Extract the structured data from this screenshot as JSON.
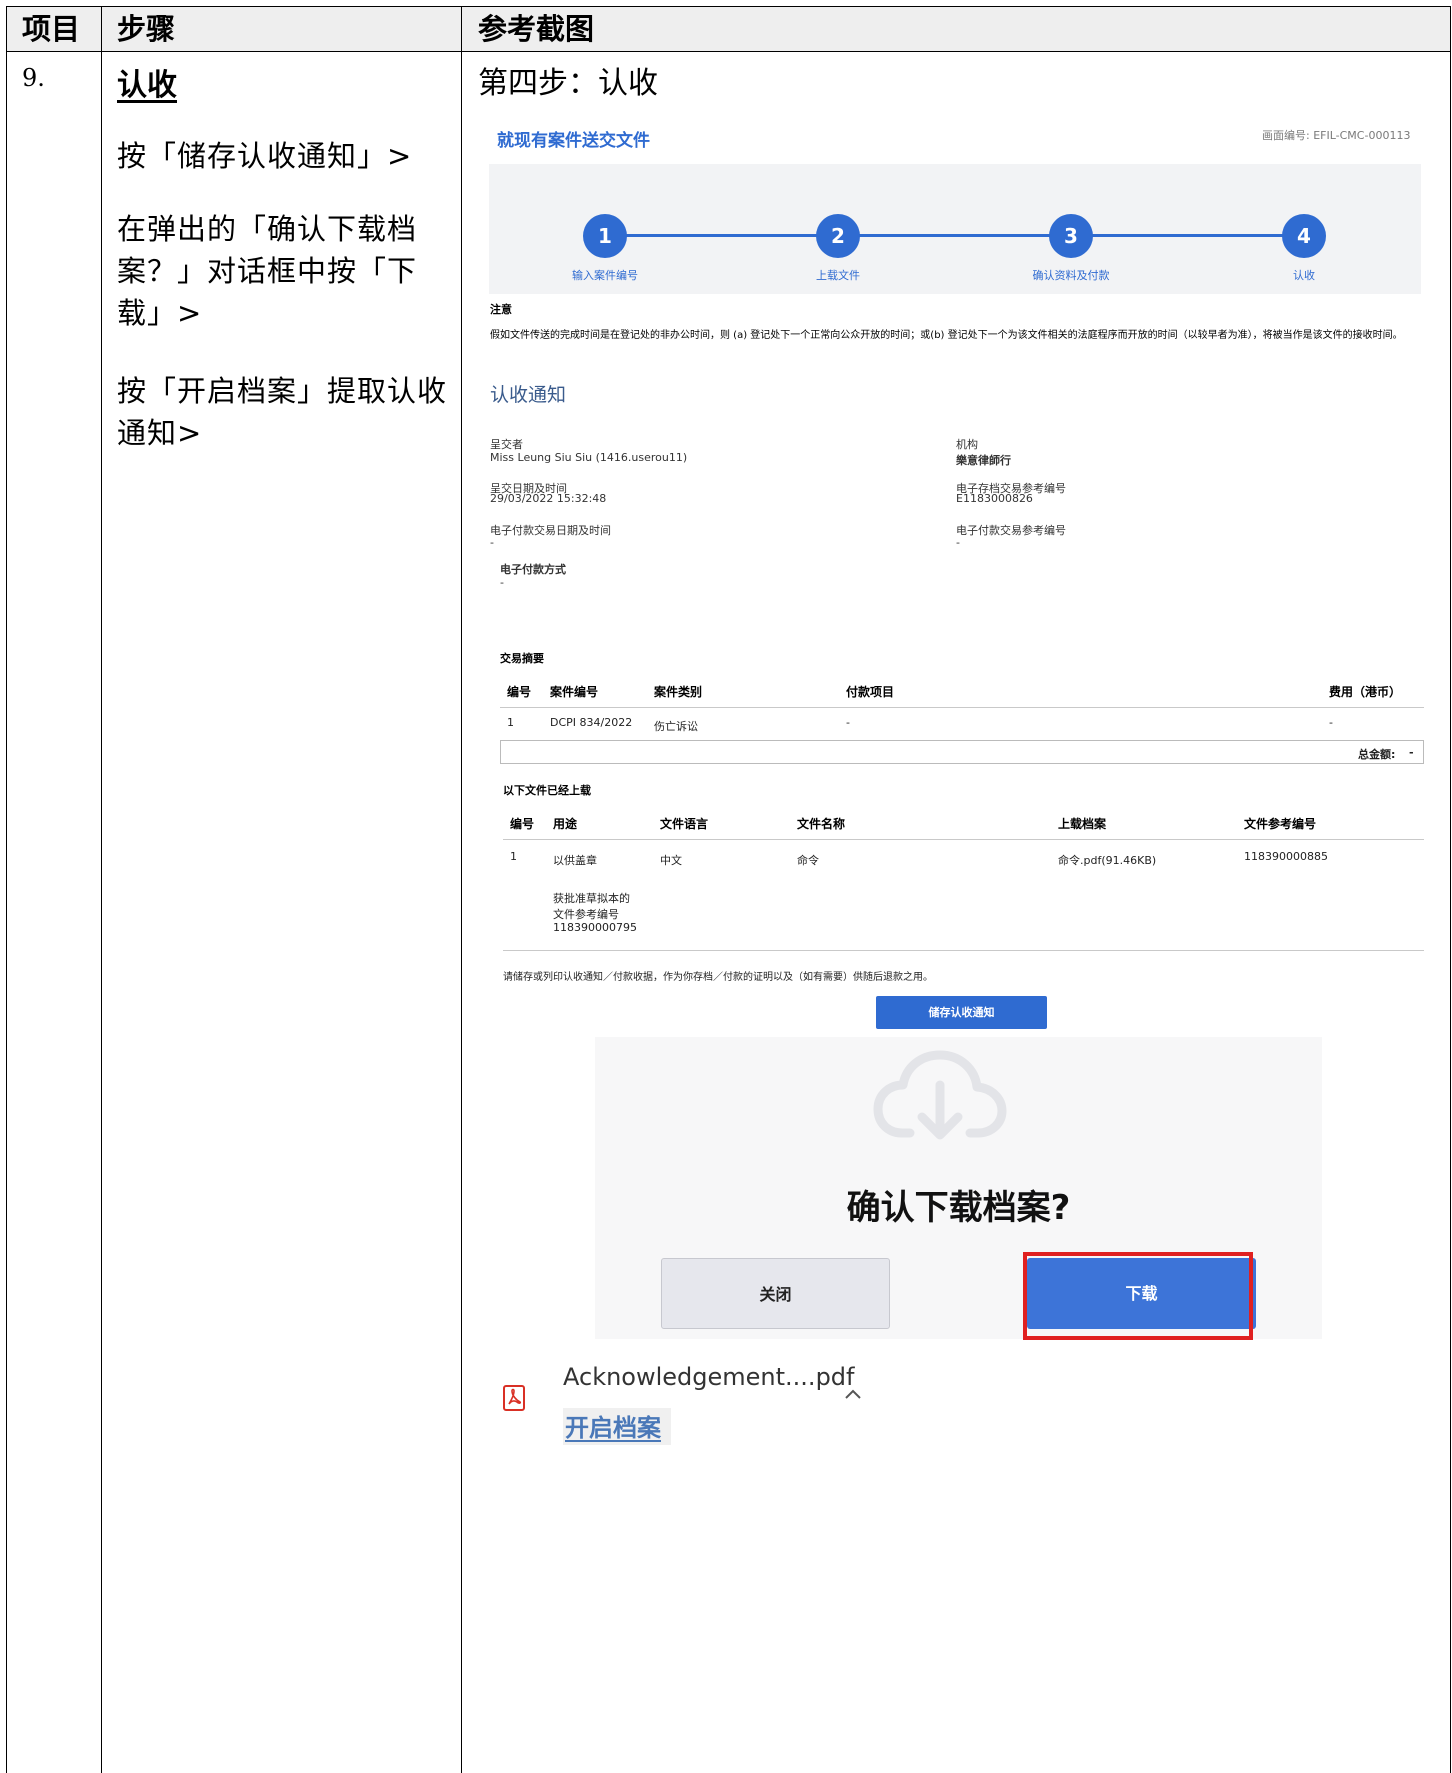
{
  "header": {
    "col1": "项目",
    "col2": "步骤",
    "col3": "参考截图"
  },
  "row": {
    "item_no": "9.",
    "step_title": "认收",
    "instructions": [
      "按「储存认收通知」>",
      "在弹出的「确认下载档案？」对话框中按「下载」>",
      "按「开启档案」提取认收通知>"
    ],
    "ref_title": "第四步：认收"
  },
  "screen": {
    "title": "就现有案件送交文件",
    "screen_code": "画面编号: EFIL-CMC-000113",
    "steps": [
      {
        "num": "1",
        "label": "输入案件编号"
      },
      {
        "num": "2",
        "label": "上载文件"
      },
      {
        "num": "3",
        "label": "确认资料及付款"
      },
      {
        "num": "4",
        "label": "认收"
      }
    ],
    "note_heading": "注意",
    "note_text": "假如文件传送的完成时间是在登记处的非办公时间，则 (a) 登记处下一个正常向公众开放的时间；或(b) 登记处下一个为该文件相关的法庭程序而开放的时间（以较早者为准），将被当作是该文件的接收时间。",
    "ack_heading": "认收通知",
    "fields": {
      "submitter_label": "呈交者",
      "submitter_value": "Miss Leung Siu Siu (1416.userou11)",
      "org_label": "机构",
      "org_value": "樂意律師行",
      "date_label": "呈交日期及时间",
      "date_value": "29/03/2022 15:32:48",
      "efile_ref_label": "电子存档交易参考编号",
      "efile_ref_value": "E1183000826",
      "epay_date_label": "电子付款交易日期及时间",
      "epay_date_value": "-",
      "epay_ref_label": "电子付款交易参考编号",
      "epay_ref_value": "-",
      "epay_method_label": "电子付款方式",
      "epay_method_value": "-"
    },
    "summary": {
      "heading": "交易摘要",
      "columns": [
        "编号",
        "案件编号",
        "案件类别",
        "付款项目",
        "费用（港币）"
      ],
      "rows": [
        [
          "1",
          "DCPI 834/2022",
          "伤亡诉讼",
          "-",
          "-"
        ]
      ],
      "total_label": "总金额:",
      "total_value": "-"
    },
    "uploaded": {
      "heading": "以下文件已经上载",
      "columns": [
        "编号",
        "用途",
        "文件语言",
        "文件名称",
        "上载档案",
        "文件参考编号"
      ],
      "rows": [
        [
          "1",
          "以供盖章",
          "中文",
          "命令",
          "命令.pdf(91.46KB)",
          "118390000885"
        ]
      ],
      "approved_draft_label": "获批准草拟本的",
      "approved_ref_label": "文件参考编号",
      "approved_ref_value": "118390000795"
    },
    "save_hint": "请储存或列印认收通知／付款收据，作为你存档／付款的证明以及（如有需要）供随后退款之用。",
    "save_button": "储存认收通知",
    "dialog": {
      "icon": "cloud-download-icon",
      "title": "确认下载档案?",
      "close_button": "关闭",
      "download_button": "下载"
    },
    "download_bar": {
      "icon": "pdf-file-icon",
      "file_name": "Acknowledgement....pdf",
      "open_link": "开启档案",
      "expand_icon": "chevron-up-icon"
    }
  },
  "colors": {
    "accent": "#2f6bd1",
    "highlight": "#e02020",
    "header_bg": "#eeeeee"
  }
}
